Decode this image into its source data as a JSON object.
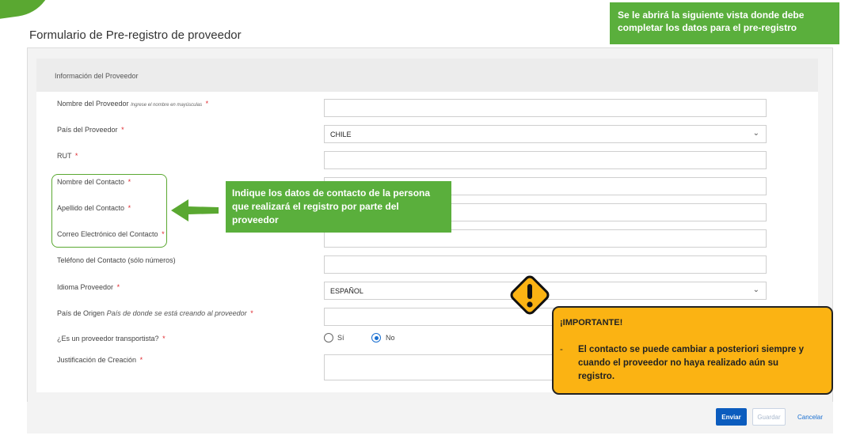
{
  "page_title": "Formulario de Pre-registro de proveedor",
  "section_header": "Información del Proveedor",
  "fields": {
    "supplier_name": {
      "label": "Nombre del Proveedor",
      "hint": "Ingrese el nombre en mayúsculas",
      "required": "*",
      "value": ""
    },
    "supplier_country": {
      "label": "País del Proveedor",
      "required": "*",
      "value": "CHILE"
    },
    "rut": {
      "label": "RUT",
      "required": "*",
      "value": ""
    },
    "contact_first_name": {
      "label": "Nombre del Contacto",
      "required": "*",
      "value": ""
    },
    "contact_last_name": {
      "label": "Apellido del Contacto",
      "required": "*",
      "value": ""
    },
    "contact_email": {
      "label": "Correo Electrónico del Contacto",
      "required": "*",
      "value": ""
    },
    "contact_phone": {
      "label": "Teléfono del Contacto (sólo números)",
      "value": ""
    },
    "supplier_language": {
      "label": "Idioma Proveedor",
      "required": "*",
      "value": "ESPAÑOL"
    },
    "origin_country": {
      "label": "País de Origen",
      "hint": "País de donde se está creando al proveedor",
      "required": "*",
      "value": ""
    },
    "is_transport": {
      "label": "¿Es un proveedor transportista?",
      "required": "*",
      "option_yes": "Sí",
      "option_no": "No",
      "selected": "No"
    },
    "justification": {
      "label": "Justificación de Creación",
      "required": "*",
      "value": ""
    }
  },
  "buttons": {
    "send": "Enviar",
    "save": "Guardar",
    "cancel": "Cancelar"
  },
  "callouts": {
    "top": "Se le abrirá la siguiente vista donde debe completar los datos para el pre-registro",
    "contact": "Indique los datos de contacto de la persona que realizará el registro por parte del proveedor",
    "important_title": "¡IMPORTANTE!",
    "important_dash": "-",
    "important_body": "El contacto se puede cambiar a posteriori siempre y cuando el proveedor no haya realizado aún su registro."
  },
  "icons": {
    "dropdown": "chevron-down-icon",
    "warning": "warning-icon",
    "arrow": "arrow-left-icon"
  },
  "colors": {
    "accent_green": "#5aaf3c",
    "primary_blue": "#0b5cbe",
    "warning_yellow": "#fbb313",
    "required_red": "#e0282e"
  }
}
